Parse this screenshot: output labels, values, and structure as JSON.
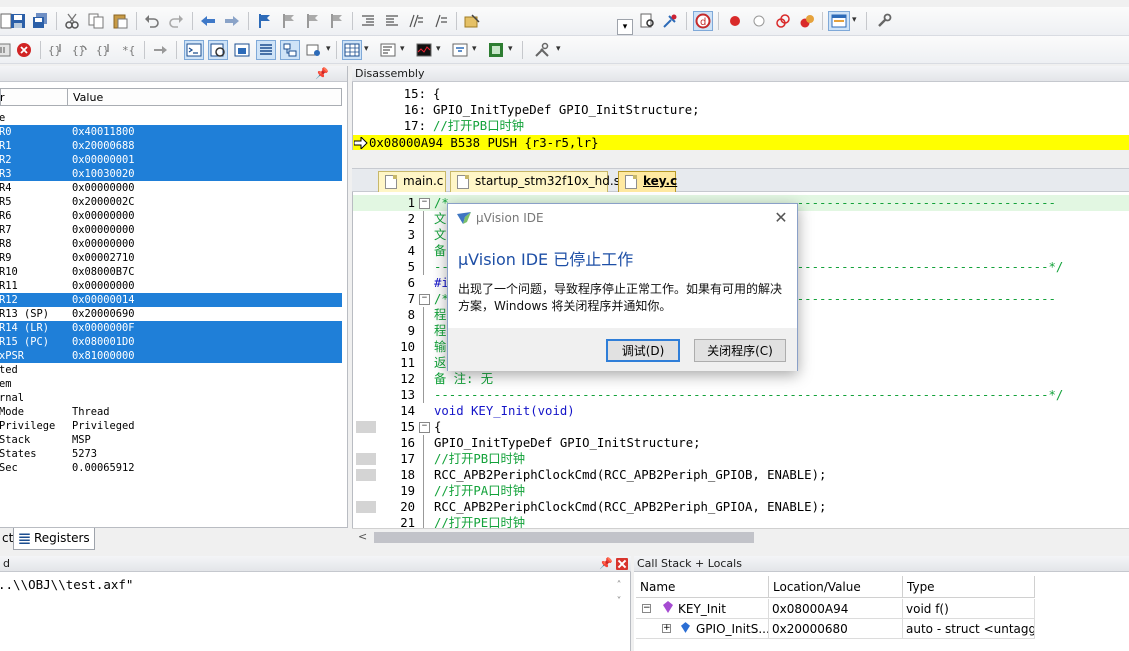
{
  "colors": {
    "selection": "#1f7fd8",
    "exec_line": "#ffff00",
    "comment": "#13a23a",
    "keyword": "#1515c9",
    "dialog_heading": "#1e4fa6"
  },
  "toolbar1": {
    "icons": [
      "save-icon",
      "save-all-icon",
      "cut-icon",
      "copy-icon",
      "paste-icon",
      "undo-icon",
      "redo-icon",
      "navigate-back-icon",
      "navigate-forward-icon",
      "bookmark-toggle-icon",
      "bookmark-prev-icon",
      "bookmark-next-icon",
      "bookmark-clear-icon",
      "indent-icon",
      "unindent-icon",
      "comment-icon",
      "uncomment-icon",
      "find-in-files-icon",
      "find-dropdown-icon",
      "incremental-find-icon",
      "debug-session-icon",
      "breakpoint-insert-icon",
      "breakpoint-enable-icon",
      "breakpoint-disable-icon",
      "breakpoint-kill-icon",
      "window-layout-icon",
      "configure-icon"
    ]
  },
  "toolbar2": {
    "icons": [
      "reset-icon",
      "run-icon",
      "stop-icon",
      "step-into-icon",
      "step-over-icon",
      "step-out-icon",
      "run-to-cursor-icon",
      "show-next-statement-icon",
      "command-window-icon",
      "disassembly-window-icon",
      "symbols-window-icon",
      "registers-window-icon",
      "call-stack-window-icon",
      "watch-windows-icon",
      "memory-windows-icon",
      "serial-windows-icon",
      "analysis-windows-icon",
      "trace-windows-icon",
      "system-viewer-icon",
      "toolbox-icon"
    ]
  },
  "registers": {
    "title": "",
    "col_name": "r",
    "col_value": "Value",
    "rows": [
      {
        "name": "e",
        "value": "",
        "selected": false
      },
      {
        "name": "R0",
        "value": "0x40011800",
        "selected": true
      },
      {
        "name": "R1",
        "value": "0x20000688",
        "selected": true
      },
      {
        "name": "R2",
        "value": "0x00000001",
        "selected": true
      },
      {
        "name": "R3",
        "value": "0x10030020",
        "selected": true
      },
      {
        "name": "R4",
        "value": "0x00000000",
        "selected": false
      },
      {
        "name": "R5",
        "value": "0x2000002C",
        "selected": false
      },
      {
        "name": "R6",
        "value": "0x00000000",
        "selected": false
      },
      {
        "name": "R7",
        "value": "0x00000000",
        "selected": false
      },
      {
        "name": "R8",
        "value": "0x00000000",
        "selected": false
      },
      {
        "name": "R9",
        "value": "0x00002710",
        "selected": false
      },
      {
        "name": "R10",
        "value": "0x08000B7C",
        "selected": false
      },
      {
        "name": "R11",
        "value": "0x00000000",
        "selected": false
      },
      {
        "name": "R12",
        "value": "0x00000014",
        "selected": true
      },
      {
        "name": "R13 (SP)",
        "value": "0x20000690",
        "selected": false
      },
      {
        "name": "R14 (LR)",
        "value": "0x0000000F",
        "selected": true
      },
      {
        "name": "R15 (PC)",
        "value": "0x080001D0",
        "selected": true
      },
      {
        "name": "xPSR",
        "value": "0x81000000",
        "selected": true
      },
      {
        "name": "ted",
        "value": "",
        "selected": false
      },
      {
        "name": "em",
        "value": "",
        "selected": false
      },
      {
        "name": "rnal",
        "value": "",
        "selected": false
      },
      {
        "name": "Mode",
        "value": "Thread",
        "selected": false
      },
      {
        "name": "Privilege",
        "value": "Privileged",
        "selected": false
      },
      {
        "name": "Stack",
        "value": "MSP",
        "selected": false
      },
      {
        "name": "States",
        "value": "5273",
        "selected": false
      },
      {
        "name": "Sec",
        "value": "0.00065912",
        "selected": false
      }
    ],
    "tabs": [
      {
        "label": "ct",
        "active": false
      },
      {
        "label": "Registers",
        "active": true
      }
    ]
  },
  "disassembly": {
    "title": "Disassembly",
    "lines": [
      {
        "num": "15:",
        "text": "{"
      },
      {
        "num": "16:",
        "text": "  GPIO_InitTypeDef GPIO_InitStructure;"
      },
      {
        "num": "17:",
        "text": "      //打开PB口时钟"
      }
    ],
    "exec_line": "0x08000A94 B538      PUSH     {r3-r5,lr}"
  },
  "editor": {
    "tabs": [
      {
        "label": "main.c",
        "active": false
      },
      {
        "label": "startup_stm32f10x_hd.s",
        "active": false
      },
      {
        "label": "key.c",
        "active": true
      }
    ],
    "lines": [
      {
        "num": "1",
        "text": "/*----------------------------------------------------------------------------------",
        "cls": "cmt",
        "fold": "box",
        "bp": false
      },
      {
        "num": "2",
        "text": "文",
        "cls": "cmt",
        "fold": "bar",
        "bp": false
      },
      {
        "num": "3",
        "text": "文",
        "cls": "cmt",
        "fold": "bar",
        "bp": false
      },
      {
        "num": "4",
        "text": "备",
        "cls": "cmt",
        "fold": "bar",
        "bp": false
      },
      {
        "num": "5",
        "text": "-----------------------------------------------------------------------------------*/",
        "cls": "cmt",
        "fold": "bar",
        "bp": false
      },
      {
        "num": "6",
        "text": "#i",
        "cls": "kw",
        "fold": "",
        "bp": false
      },
      {
        "num": "7",
        "text": "/*----------------------------------------------------------------------------------",
        "cls": "cmt",
        "fold": "box",
        "bp": false
      },
      {
        "num": "8",
        "text": "程",
        "cls": "cmt",
        "fold": "bar",
        "bp": false
      },
      {
        "num": "9",
        "text": "程                                         端口引脚, 端口工作频率, 端口输入模式",
        "cls": "cmt",
        "fold": "bar",
        "bp": false
      },
      {
        "num": "10",
        "text": "输",
        "cls": "cmt",
        "fold": "bar",
        "bp": false
      },
      {
        "num": "11",
        "text": "返",
        "cls": "cmt",
        "fold": "bar",
        "bp": false
      },
      {
        "num": "12",
        "text": "备    注: 无",
        "cls": "cmt",
        "fold": "bar",
        "bp": false
      },
      {
        "num": "13",
        "text": "-----------------------------------------------------------------------------------*/",
        "cls": "cmt",
        "fold": "bar",
        "bp": false
      },
      {
        "num": "14",
        "text": "void KEY_Init(void)",
        "cls": "kw",
        "fold": "",
        "bp": false
      },
      {
        "num": "15",
        "text": "{",
        "cls": "",
        "fold": "box",
        "bp": true
      },
      {
        "num": "16",
        "text": "  GPIO_InitTypeDef GPIO_InitStructure;",
        "cls": "",
        "fold": "bar",
        "bp": false
      },
      {
        "num": "17",
        "text": "  //打开PB口时钟",
        "cls": "cmt",
        "fold": "bar",
        "bp": true
      },
      {
        "num": "18",
        "text": "  RCC_APB2PeriphClockCmd(RCC_APB2Periph_GPIOB, ENABLE);",
        "cls": "",
        "fold": "bar",
        "bp": true
      },
      {
        "num": "19",
        "text": "  //打开PA口时钟",
        "cls": "cmt",
        "fold": "bar",
        "bp": false
      },
      {
        "num": "20",
        "text": "  RCC_APB2PeriphClockCmd(RCC_APB2Periph_GPIOA, ENABLE);",
        "cls": "",
        "fold": "bar",
        "bp": true
      },
      {
        "num": "21",
        "text": "  //打开PE口时钟",
        "cls": "cmt",
        "fold": "bar",
        "bp": false
      }
    ]
  },
  "dialog": {
    "title": "µVision IDE",
    "heading": "µVision IDE 已停止工作",
    "message": "出现了一个问题，导致程序停止正常工作。如果有可用的解决方案，Windows 将关闭程序并通知你。",
    "debug_button": "调试(D)",
    "close_button": "关闭程序(C)"
  },
  "command": {
    "title": "d",
    "output": "..\\\\OBJ\\\\test.axf\""
  },
  "callstack": {
    "title": "Call Stack + Locals",
    "col_name": "Name",
    "col_location": "Location/Value",
    "col_type": "Type",
    "rows": [
      {
        "name": "KEY_Init",
        "location": "0x08000A94",
        "type": "void f()"
      },
      {
        "name": "GPIO_InitS...",
        "location": "0x20000680",
        "type": "auto - struct <untagg..."
      }
    ]
  }
}
